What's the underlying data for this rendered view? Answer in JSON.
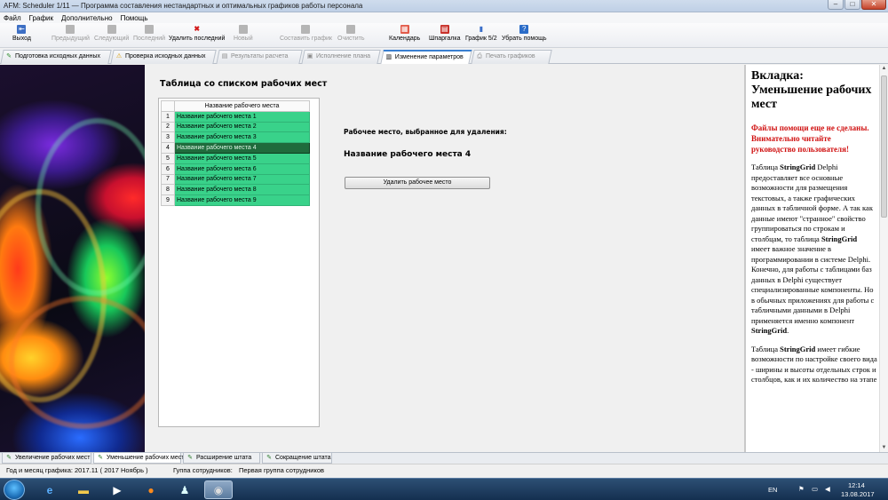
{
  "window": {
    "title": "AFM: Scheduler 1/11 — Программа составления  нестандартных и оптимальных графиков работы персонала",
    "buttons": [
      "–",
      "□",
      "✕"
    ]
  },
  "menu": [
    "Файл",
    "График",
    "Дополнительно",
    "Помощь"
  ],
  "toolbar": {
    "items": [
      {
        "label": "Выход",
        "icon": "exit-icon"
      },
      {
        "label": "Предыдущий",
        "icon": "previous-icon",
        "enabled": false
      },
      {
        "label": "Следующий",
        "icon": "next-icon",
        "enabled": false
      },
      {
        "label": "Последний",
        "icon": "last-icon",
        "enabled": false
      },
      {
        "label": "Удалить последний",
        "icon": "delete-x-icon"
      },
      {
        "label": "Новый",
        "icon": "new-icon",
        "enabled": false
      },
      {
        "label": "Составить график",
        "icon": "build-icon",
        "enabled": false
      },
      {
        "label": "Очистить",
        "icon": "clear-icon",
        "enabled": false
      },
      {
        "label": "Календарь",
        "icon": "calendar-icon"
      },
      {
        "label": "Шпаргалка",
        "icon": "pdf-icon"
      },
      {
        "label": "График 5/2",
        "icon": "bar-chart-icon"
      },
      {
        "label": "Убрать помощь",
        "icon": "help-icon"
      }
    ]
  },
  "tabs": [
    "Подготовка исходных данных",
    "Проверка исходных данных",
    "Результаты расчета",
    "Исполнение плана",
    "Изменение параметров",
    "Печать графиков"
  ],
  "active_tab": "Изменение параметров",
  "panel": {
    "heading": "Таблица со списком рабочих мест",
    "grid": {
      "header": "Название рабочего места",
      "rows": [
        {
          "num": "1",
          "name": "Название рабочего места 1"
        },
        {
          "num": "2",
          "name": "Название рабочего места 2"
        },
        {
          "num": "3",
          "name": "Название рабочего места 3"
        },
        {
          "num": "4",
          "name": "Название рабочего места 4"
        },
        {
          "num": "5",
          "name": "Название рабочего места 5"
        },
        {
          "num": "6",
          "name": "Название рабочего места 6"
        },
        {
          "num": "7",
          "name": "Название рабочего места 7"
        },
        {
          "num": "8",
          "name": "Название рабочего места 8"
        },
        {
          "num": "9",
          "name": "Название рабочего места 9"
        }
      ],
      "selected_row": "4"
    },
    "selected_label": "Рабочее место, выбранное для удаления:",
    "selected_value": "Название рабочего места 4",
    "delete_button": "Удалить рабочее место"
  },
  "help": {
    "title": "Вкладка: Уменьшение рабочих мест",
    "warning": "Файлы помощи еще не сделаны. Внимательно читайте руководство пользователя!",
    "p1": [
      "Таблица ",
      "StringGrid",
      " Delphi предоставляет все основные возможности для размещения текстовых, а также графических данных в табличной форме. А так как данные имеют \"странное\" свойство группироваться по строкам и столбцам, то таблица ",
      "StringGrid",
      " имеет важное значение в программировании в системе Delphi. Конечно, для работы с таблицами баз данных в Delphi существует специализированные компоненты. Но в обычных приложениях для работы с табличными данными в Delphi применяется именно компонент ",
      "StringGrid"
    ],
    "p2": [
      "Таблица ",
      "StringGrid",
      " имеет гибкие возможности по настройке своего вида - ширины и высоты отдельных строк и столбцов, как и их количество на этапе"
    ]
  },
  "bottom_tabs": [
    "Увеличение рабочих мест",
    "Уменьшение рабочих мест",
    "Расширение штата",
    "Сокращение штата"
  ],
  "active_bottom_tab": "Уменьшение рабочих мест",
  "status": {
    "month_label": "Год и месяц графика:",
    "month_value": "2017.11   ( 2017  Ноябрь )",
    "group_label": "Гуппа сотрудников:",
    "group_value": "Первая группа сотрудников"
  },
  "taskbar": {
    "lang": "EN",
    "time": "12:14",
    "date": "13.08.2017"
  },
  "colors": {
    "grid_row": "#39d28a",
    "grid_row_selected": "#1f6b3c",
    "help_warning": "#d01010",
    "active_tab_accent": "#3a7fd0"
  }
}
